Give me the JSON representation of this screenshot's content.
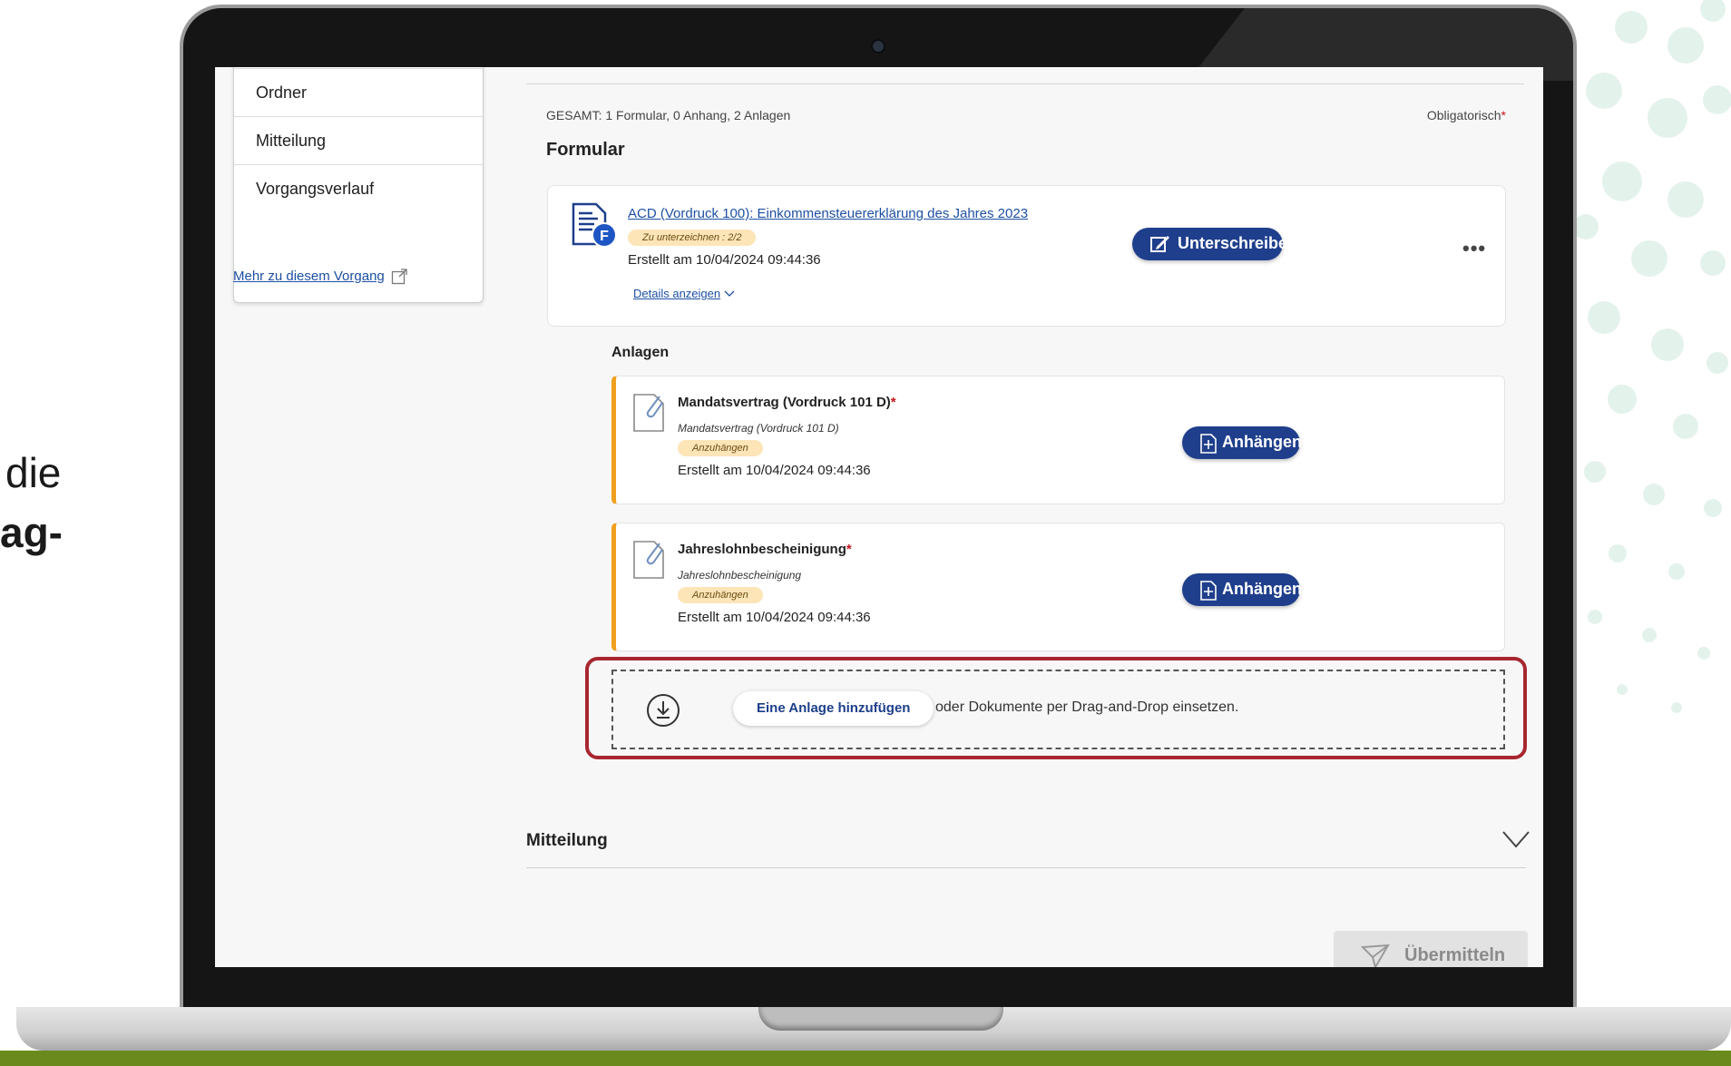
{
  "side_text": {
    "line1": "die",
    "line2": "ag-"
  },
  "nav": {
    "items": [
      "Ordner",
      "Mitteilung",
      "Vorgangsverlauf"
    ],
    "more_link": "Mehr zu diesem Vorgang"
  },
  "header": {
    "summary": "GESAMT: 1 Formular, 0 Anhang, 2 Anlagen",
    "mandatory_label": "Obligatorisch",
    "mandatory_marker": "*",
    "section_title": "Formular"
  },
  "form": {
    "title": "ACD (Vordruck 100): Einkommensteuererklärung des Jahres 2023",
    "badge": "Zu unterzeichnen : 2/2",
    "created": "Erstellt am 10/04/2024 09:44:36",
    "details_link": "Details anzeigen",
    "sign_button": "Unterschreiben",
    "more_menu": "•••",
    "icon": "form-document-icon"
  },
  "attachments": {
    "title": "Anlagen",
    "items": [
      {
        "title": "Mandatsvertrag (Vordruck 101 D)",
        "required_marker": "*",
        "subtitle": "Mandatsvertrag (Vordruck 101 D)",
        "badge": "Anzuhängen",
        "created": "Erstellt am 10/04/2024 09:44:36",
        "button": "Anhängen"
      },
      {
        "title": "Jahreslohnbescheinigung",
        "required_marker": "*",
        "subtitle": "Jahreslohnbescheinigung",
        "badge": "Anzuhängen",
        "created": "Erstellt am 10/04/2024 09:44:36",
        "button": "Anhängen"
      }
    ]
  },
  "dropzone": {
    "button": "Eine Anlage hinzufügen",
    "text": "oder Dokumente per Drag-and-Drop einsetzen."
  },
  "message_section": {
    "title": "Mitteilung"
  },
  "submit": {
    "label": "Übermitteln"
  },
  "colors": {
    "primary": "#1f3f8c",
    "link": "#1d4fa3",
    "attachment_accent": "#f0a020",
    "badge_bg": "#fde5b8",
    "highlight": "#a8262f",
    "required": "#c4161c"
  }
}
